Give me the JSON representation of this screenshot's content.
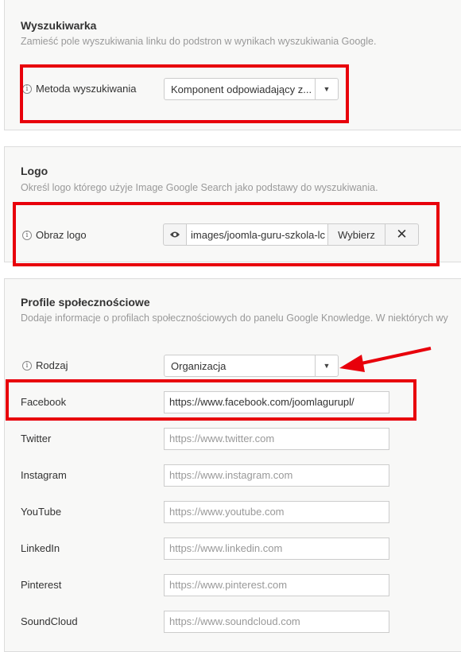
{
  "search": {
    "title": "Wyszukiwarka",
    "description": "Zamieść pole wyszukiwania linku do podstron w wynikach wyszukiwania Google.",
    "method_label": "Metoda wyszukiwania",
    "method_value": "Komponent odpowiadający z..."
  },
  "logo": {
    "title": "Logo",
    "description": "Określ logo którego użyje Image Google Search jako podstawy do wyszukiwania.",
    "image_label": "Obraz logo",
    "image_path": "images/joomla-guru-szkola-lc",
    "select_button": "Wybierz"
  },
  "social": {
    "title": "Profile społecznościowe",
    "description": "Dodaje informacje o profilach społecznościowych do panelu Google Knowledge. W niektórych wy",
    "type_label": "Rodzaj",
    "type_value": "Organizacja",
    "fields": [
      {
        "label": "Facebook",
        "value": "https://www.facebook.com/joomlagurupl/",
        "placeholder": ""
      },
      {
        "label": "Twitter",
        "value": "",
        "placeholder": "https://www.twitter.com"
      },
      {
        "label": "Instagram",
        "value": "",
        "placeholder": "https://www.instagram.com"
      },
      {
        "label": "YouTube",
        "value": "",
        "placeholder": "https://www.youtube.com"
      },
      {
        "label": "LinkedIn",
        "value": "",
        "placeholder": "https://www.linkedin.com"
      },
      {
        "label": "Pinterest",
        "value": "",
        "placeholder": "https://www.pinterest.com"
      },
      {
        "label": "SoundCloud",
        "value": "",
        "placeholder": "https://www.soundcloud.com"
      }
    ]
  },
  "icons": {
    "info": "info-icon",
    "caret": "chevron-down-icon",
    "eye": "eye-icon",
    "clear": "close-icon"
  },
  "colors": {
    "highlight": "#e8000b",
    "panel_bg": "#f8f8f7",
    "placeholder_text": "#999999"
  }
}
